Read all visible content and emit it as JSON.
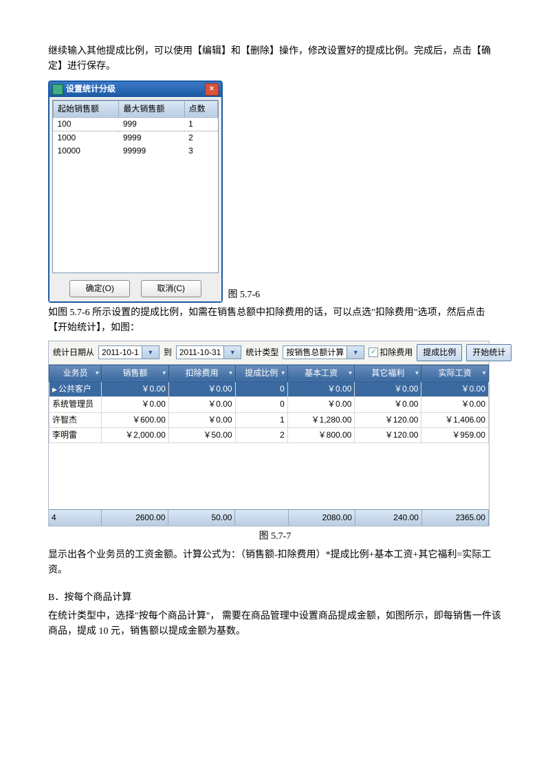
{
  "paragraphs": {
    "p1": "继续输入其他提成比例，可以使用【编辑】和【删除】操作，修改设置好的提成比例。完成后，点击【确定】进行保存。",
    "p2": "如图 5.7-6 所示设置的提成比例，如需在销售总额中扣除费用的话，可以点选\"扣除费用\"选项，然后点击【开始统计】，如图：",
    "p3": "显示出各个业务员的工资金额。计算公式为：（销售额-扣除费用）*提成比例+基本工资+其它福利=实际工资。",
    "p4_heading": "B．按每个商品计算",
    "p4": "在统计类型中，选择\"按每个商品计算\"， 需要在商品管理中设置商品提成金额，如图所示，即每销售一件该商品，提成 10 元，销售额以提成金额为基数。"
  },
  "dialog1": {
    "title": "设置统计分级",
    "columns": [
      "起始销售额",
      "最大销售额",
      "点数"
    ],
    "rows": [
      [
        "100",
        "999",
        "1"
      ],
      [
        "1000",
        "9999",
        "2"
      ],
      [
        "10000",
        "99999",
        "3"
      ]
    ],
    "ok": "确定(O)",
    "cancel": "取消(C)",
    "caption": "图 5.7-6"
  },
  "panel2": {
    "toolbar": {
      "lbl_date_from": "统计日期从",
      "date_from": "2011-10-1",
      "lbl_to": "到",
      "date_to": "2011-10-31",
      "lbl_type": "统计类型",
      "type_value": "按销售总额计算",
      "chk_label": "扣除费用",
      "btn_ratio": "提成比例",
      "btn_start": "开始统计"
    },
    "columns": [
      "业务员",
      "销售额",
      "扣除费用",
      "提成比例",
      "基本工资",
      "其它福利",
      "实际工资"
    ],
    "rows": [
      {
        "name": "公共客户",
        "sales": "￥0.00",
        "deduct": "￥0.00",
        "ratio": "0",
        "base": "￥0.00",
        "welfare": "￥0.00",
        "actual": "￥0.00",
        "sel": true
      },
      {
        "name": "系统管理员",
        "sales": "￥0.00",
        "deduct": "￥0.00",
        "ratio": "0",
        "base": "￥0.00",
        "welfare": "￥0.00",
        "actual": "￥0.00"
      },
      {
        "name": "许智杰",
        "sales": "￥600.00",
        "deduct": "￥0.00",
        "ratio": "1",
        "base": "￥1,280.00",
        "welfare": "￥120.00",
        "actual": "￥1,406.00"
      },
      {
        "name": "李明雷",
        "sales": "￥2,000.00",
        "deduct": "￥50.00",
        "ratio": "2",
        "base": "￥800.00",
        "welfare": "￥120.00",
        "actual": "￥959.00"
      }
    ],
    "footer": [
      "4",
      "2600.00",
      "50.00",
      "",
      "2080.00",
      "240.00",
      "2365.00"
    ],
    "caption": "图 5.7-7"
  }
}
